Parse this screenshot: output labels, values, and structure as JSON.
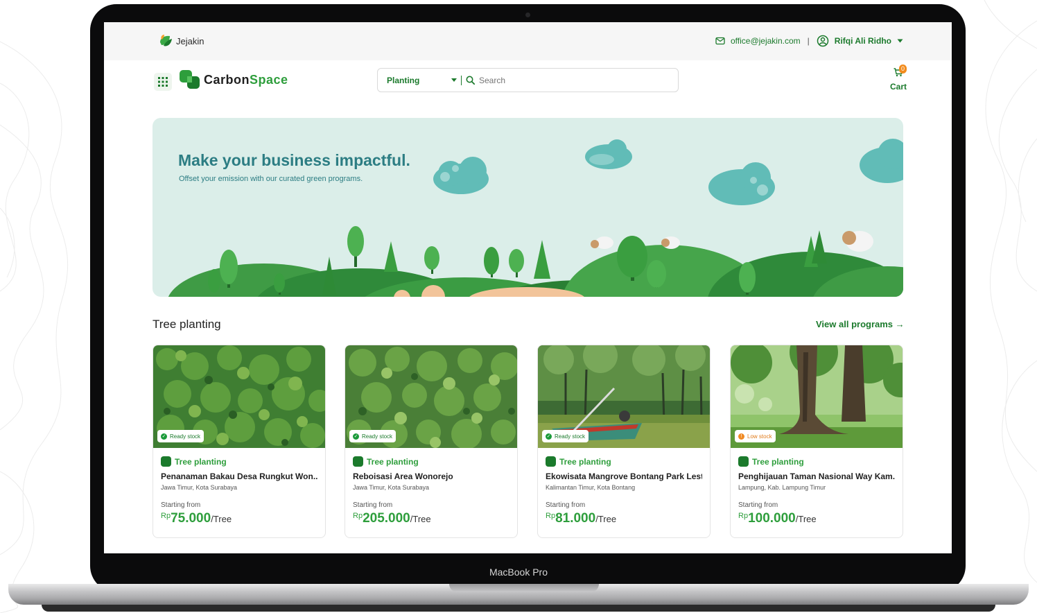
{
  "util_bar": {
    "brand": "Jejakin",
    "email": "office@jejakin.com",
    "separator": "|",
    "user_name": "Rifqi Ali Ridho"
  },
  "nav": {
    "logo_part1": "Carbon",
    "logo_part2": "Space",
    "search_category": "Planting",
    "search_placeholder": "Search",
    "cart_count": "0",
    "cart_label": "Cart"
  },
  "hero": {
    "title": "Make your business impactful.",
    "subtitle": "Offset your emission with our curated green programs."
  },
  "section": {
    "title": "Tree planting",
    "view_all": "View all programs →"
  },
  "cards": [
    {
      "stock": "Ready stock",
      "stock_status": "ready",
      "category": "Tree planting",
      "name": "Penanaman Bakau Desa Rungkut Won...",
      "location": "Jawa Timur, Kota Surabaya",
      "starting": "Starting from",
      "currency": "Rp",
      "price": "75.000",
      "unit": "/Tree"
    },
    {
      "stock": "Ready stock",
      "stock_status": "ready",
      "category": "Tree planting",
      "name": "Reboisasi Area Wonorejo",
      "location": "Jawa Timur, Kota Surabaya",
      "starting": "Starting from",
      "currency": "Rp",
      "price": "205.000",
      "unit": "/Tree"
    },
    {
      "stock": "Ready stock",
      "stock_status": "ready",
      "category": "Tree planting",
      "name": "Ekowisata Mangrove Bontang Park Lest...",
      "location": "Kalimantan Timur, Kota Bontang",
      "starting": "Starting from",
      "currency": "Rp",
      "price": "81.000",
      "unit": "/Tree"
    },
    {
      "stock": "Low stock",
      "stock_status": "low",
      "category": "Tree planting",
      "name": "Penghijauan Taman Nasional Way Kam...",
      "location": "Lampung, Kab. Lampung Timur",
      "starting": "Starting from",
      "currency": "Rp",
      "price": "100.000",
      "unit": "/Tree"
    }
  ],
  "device_label": "MacBook Pro",
  "colors": {
    "brand_green": "#1b7a2c",
    "accent_green": "#2e9e3c",
    "hero_bg": "#dbeee9",
    "hero_text": "#2c7d83",
    "low_stock": "#f08a24"
  }
}
